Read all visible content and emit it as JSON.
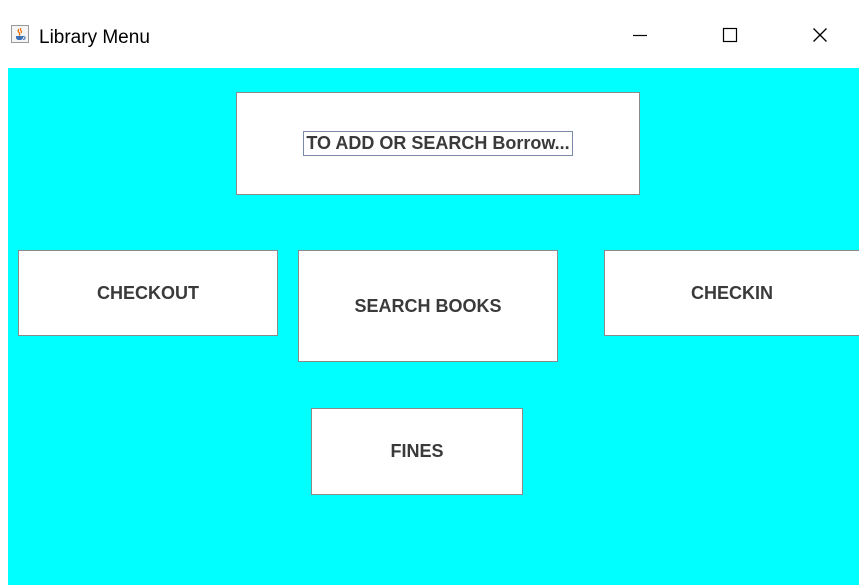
{
  "window": {
    "title": "Library Menu",
    "icon": "java-cup-icon",
    "controls": {
      "minimize": "minimize-icon",
      "maximize": "maximize-icon",
      "close": "close-icon"
    }
  },
  "content": {
    "background": "#00ffff"
  },
  "buttons": {
    "borrower": "TO ADD OR SEARCH Borrow...",
    "checkout": "CHECKOUT",
    "search_books": "SEARCH BOOKS",
    "checkin": "CHECKIN",
    "fines": "FINES"
  }
}
